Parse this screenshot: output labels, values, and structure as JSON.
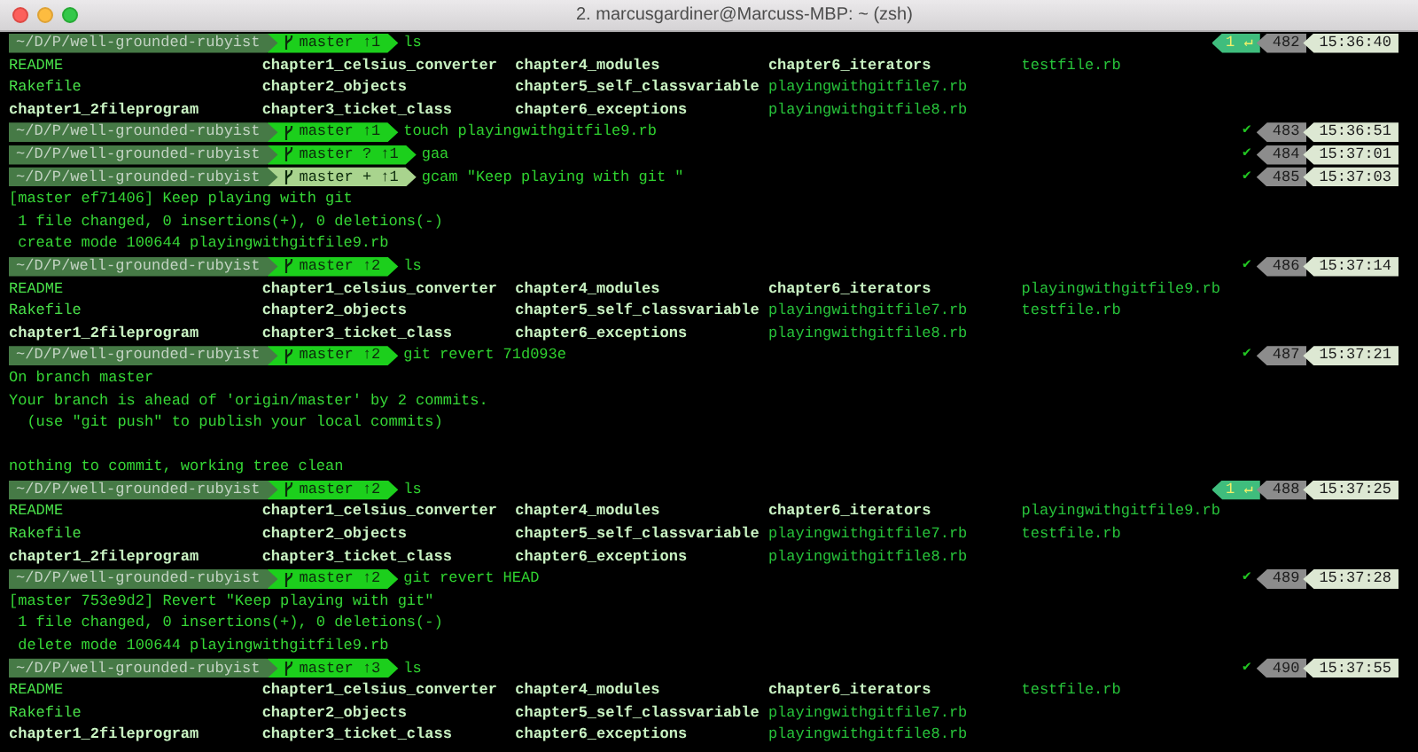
{
  "window": {
    "title": "2. marcusgardiner@Marcuss-MBP: ~ (zsh)"
  },
  "lines": [
    {
      "kind": "prompt",
      "dir": "~/D/P/well-grounded-rubyist",
      "git": "master ↑1",
      "staged": false,
      "command": "ls",
      "right": {
        "kind": "error",
        "status": "1 ↵",
        "history": "482",
        "time": "15:36:40"
      }
    },
    {
      "kind": "ls",
      "cells": [
        {
          "text": "README",
          "kind": "plain"
        },
        {
          "text": "chapter1_celsius_converter",
          "kind": "dir"
        },
        {
          "text": "chapter4_modules",
          "kind": "dir"
        },
        {
          "text": "chapter6_iterators",
          "kind": "dir"
        },
        {
          "text": "testfile.rb",
          "kind": "ruby"
        }
      ]
    },
    {
      "kind": "ls",
      "cells": [
        {
          "text": "Rakefile",
          "kind": "plain"
        },
        {
          "text": "chapter2_objects",
          "kind": "dir"
        },
        {
          "text": "chapter5_self_classvariable",
          "kind": "dir"
        },
        {
          "text": "playingwithgitfile7.rb",
          "kind": "ruby"
        }
      ]
    },
    {
      "kind": "ls",
      "cells": [
        {
          "text": "chapter1_2fileprogram",
          "kind": "dir"
        },
        {
          "text": "chapter3_ticket_class",
          "kind": "dir"
        },
        {
          "text": "chapter6_exceptions",
          "kind": "dir"
        },
        {
          "text": "playingwithgitfile8.rb",
          "kind": "ruby"
        }
      ]
    },
    {
      "kind": "prompt",
      "dir": "~/D/P/well-grounded-rubyist",
      "git": "master ↑1",
      "staged": false,
      "command": "touch playingwithgitfile9.rb",
      "right": {
        "kind": "ok",
        "status": "✔",
        "history": "483",
        "time": "15:36:51"
      }
    },
    {
      "kind": "prompt",
      "dir": "~/D/P/well-grounded-rubyist",
      "git": "master ? ↑1",
      "staged": false,
      "command": "gaa",
      "right": {
        "kind": "ok",
        "status": "✔",
        "history": "484",
        "time": "15:37:01"
      }
    },
    {
      "kind": "prompt",
      "dir": "~/D/P/well-grounded-rubyist",
      "git": "master + ↑1",
      "staged": true,
      "command": "gcam \"Keep playing with git \"",
      "right": {
        "kind": "ok",
        "status": "✔",
        "history": "485",
        "time": "15:37:03"
      }
    },
    {
      "kind": "output",
      "text": "[master ef71406] Keep playing with git"
    },
    {
      "kind": "output",
      "text": " 1 file changed, 0 insertions(+), 0 deletions(-)"
    },
    {
      "kind": "output",
      "text": " create mode 100644 playingwithgitfile9.rb"
    },
    {
      "kind": "prompt",
      "dir": "~/D/P/well-grounded-rubyist",
      "git": "master ↑2",
      "staged": false,
      "command": "ls",
      "right": {
        "kind": "ok",
        "status": "✔",
        "history": "486",
        "time": "15:37:14"
      }
    },
    {
      "kind": "ls",
      "cells": [
        {
          "text": "README",
          "kind": "plain"
        },
        {
          "text": "chapter1_celsius_converter",
          "kind": "dir"
        },
        {
          "text": "chapter4_modules",
          "kind": "dir"
        },
        {
          "text": "chapter6_iterators",
          "kind": "dir"
        },
        {
          "text": "playingwithgitfile9.rb",
          "kind": "ruby"
        }
      ]
    },
    {
      "kind": "ls",
      "cells": [
        {
          "text": "Rakefile",
          "kind": "plain"
        },
        {
          "text": "chapter2_objects",
          "kind": "dir"
        },
        {
          "text": "chapter5_self_classvariable",
          "kind": "dir"
        },
        {
          "text": "playingwithgitfile7.rb",
          "kind": "ruby"
        },
        {
          "text": "testfile.rb",
          "kind": "ruby"
        }
      ]
    },
    {
      "kind": "ls",
      "cells": [
        {
          "text": "chapter1_2fileprogram",
          "kind": "dir"
        },
        {
          "text": "chapter3_ticket_class",
          "kind": "dir"
        },
        {
          "text": "chapter6_exceptions",
          "kind": "dir"
        },
        {
          "text": "playingwithgitfile8.rb",
          "kind": "ruby"
        }
      ]
    },
    {
      "kind": "prompt",
      "dir": "~/D/P/well-grounded-rubyist",
      "git": "master ↑2",
      "staged": false,
      "command": "git revert 71d093e",
      "right": {
        "kind": "ok",
        "status": "✔",
        "history": "487",
        "time": "15:37:21"
      }
    },
    {
      "kind": "output",
      "text": "On branch master"
    },
    {
      "kind": "output",
      "text": "Your branch is ahead of 'origin/master' by 2 commits."
    },
    {
      "kind": "output",
      "text": "  (use \"git push\" to publish your local commits)"
    },
    {
      "kind": "blank"
    },
    {
      "kind": "output",
      "text": "nothing to commit, working tree clean"
    },
    {
      "kind": "prompt",
      "dir": "~/D/P/well-grounded-rubyist",
      "git": "master ↑2",
      "staged": false,
      "command": "ls",
      "right": {
        "kind": "error",
        "status": "1 ↵",
        "history": "488",
        "time": "15:37:25"
      }
    },
    {
      "kind": "ls",
      "cells": [
        {
          "text": "README",
          "kind": "plain"
        },
        {
          "text": "chapter1_celsius_converter",
          "kind": "dir"
        },
        {
          "text": "chapter4_modules",
          "kind": "dir"
        },
        {
          "text": "chapter6_iterators",
          "kind": "dir"
        },
        {
          "text": "playingwithgitfile9.rb",
          "kind": "ruby"
        }
      ]
    },
    {
      "kind": "ls",
      "cells": [
        {
          "text": "Rakefile",
          "kind": "plain"
        },
        {
          "text": "chapter2_objects",
          "kind": "dir"
        },
        {
          "text": "chapter5_self_classvariable",
          "kind": "dir"
        },
        {
          "text": "playingwithgitfile7.rb",
          "kind": "ruby"
        },
        {
          "text": "testfile.rb",
          "kind": "ruby"
        }
      ]
    },
    {
      "kind": "ls",
      "cells": [
        {
          "text": "chapter1_2fileprogram",
          "kind": "dir"
        },
        {
          "text": "chapter3_ticket_class",
          "kind": "dir"
        },
        {
          "text": "chapter6_exceptions",
          "kind": "dir"
        },
        {
          "text": "playingwithgitfile8.rb",
          "kind": "ruby"
        }
      ]
    },
    {
      "kind": "prompt",
      "dir": "~/D/P/well-grounded-rubyist",
      "git": "master ↑2",
      "staged": false,
      "command": "git revert HEAD",
      "right": {
        "kind": "ok",
        "status": "✔",
        "history": "489",
        "time": "15:37:28"
      }
    },
    {
      "kind": "output",
      "text": "[master 753e9d2] Revert \"Keep playing with git\""
    },
    {
      "kind": "output",
      "text": " 1 file changed, 0 insertions(+), 0 deletions(-)"
    },
    {
      "kind": "output",
      "text": " delete mode 100644 playingwithgitfile9.rb"
    },
    {
      "kind": "prompt",
      "dir": "~/D/P/well-grounded-rubyist",
      "git": "master ↑3",
      "staged": false,
      "command": "ls",
      "right": {
        "kind": "ok",
        "status": "✔",
        "history": "490",
        "time": "15:37:55"
      }
    },
    {
      "kind": "ls",
      "cells": [
        {
          "text": "README",
          "kind": "plain"
        },
        {
          "text": "chapter1_celsius_converter",
          "kind": "dir"
        },
        {
          "text": "chapter4_modules",
          "kind": "dir"
        },
        {
          "text": "chapter6_iterators",
          "kind": "dir"
        },
        {
          "text": "testfile.rb",
          "kind": "ruby"
        }
      ]
    },
    {
      "kind": "ls",
      "cells": [
        {
          "text": "Rakefile",
          "kind": "plain"
        },
        {
          "text": "chapter2_objects",
          "kind": "dir"
        },
        {
          "text": "chapter5_self_classvariable",
          "kind": "dir"
        },
        {
          "text": "playingwithgitfile7.rb",
          "kind": "ruby"
        }
      ]
    },
    {
      "kind": "ls",
      "cells": [
        {
          "text": "chapter1_2fileprogram",
          "kind": "dir"
        },
        {
          "text": "chapter3_ticket_class",
          "kind": "dir"
        },
        {
          "text": "chapter6_exceptions",
          "kind": "dir"
        },
        {
          "text": "playingwithgitfile8.rb",
          "kind": "ruby"
        }
      ]
    }
  ]
}
